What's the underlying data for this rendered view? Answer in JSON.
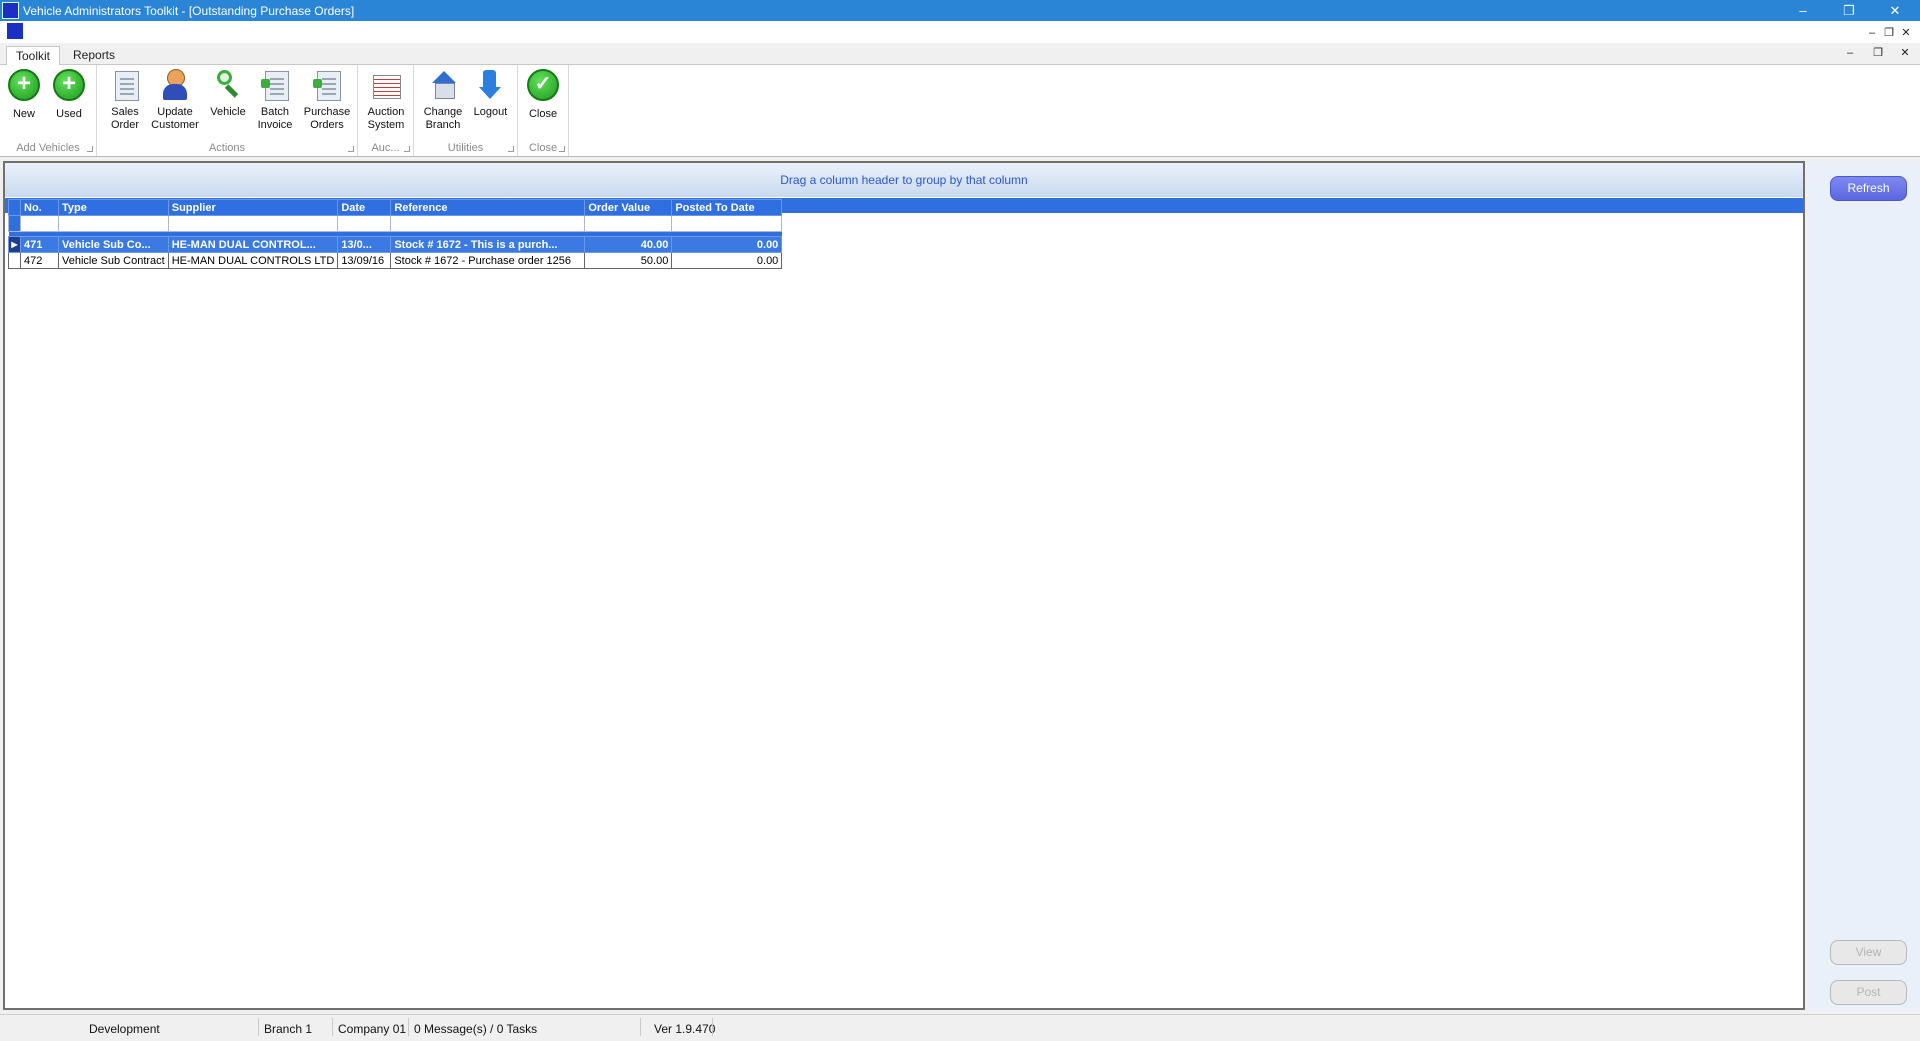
{
  "window": {
    "title": "Vehicle Administrators Toolkit - [Outstanding Purchase Orders]"
  },
  "ribbon": {
    "tabs": [
      "Toolkit",
      "Reports"
    ],
    "groups": {
      "add_vehicles": {
        "label": "Add Vehicles",
        "buttons": [
          "New",
          "Used"
        ]
      },
      "actions": {
        "label": "Actions",
        "buttons": [
          [
            "Sales",
            "Order"
          ],
          [
            "Update",
            "Customer"
          ],
          [
            "Vehicle"
          ],
          [
            "Batch",
            "Invoice"
          ],
          [
            "Purchase",
            "Orders"
          ]
        ]
      },
      "auction": {
        "label": "Auc...",
        "buttons": [
          [
            "Auction",
            "System"
          ]
        ]
      },
      "utilities": {
        "label": "Utilities",
        "buttons": [
          [
            "Change",
            "Branch"
          ],
          [
            "Logout"
          ]
        ]
      },
      "close": {
        "label": "Close",
        "buttons": [
          "Close"
        ]
      }
    }
  },
  "grid": {
    "group_hint": "Drag a column header to group by that column",
    "columns": [
      "No.",
      "Type",
      "Supplier",
      "Date",
      "Reference",
      "Order Value",
      "Posted To Date"
    ],
    "rows": [
      [
        "471",
        "Vehicle Sub Co...",
        "HE-MAN DUAL CONTROL...",
        "13/0...",
        "Stock # 1672 - This is a purch...",
        "40.00",
        "0.00"
      ],
      [
        "472",
        "Vehicle Sub Contract",
        "HE-MAN DUAL CONTROLS LTD",
        "13/09/16",
        "Stock # 1672 - Purchase order 1256",
        "50.00",
        "0.00"
      ]
    ],
    "selected_row": 0
  },
  "side": {
    "refresh": "Refresh",
    "view": "View",
    "post": "Post"
  },
  "status": {
    "environment": "Development",
    "branch": "Branch 1",
    "company": "Company 01",
    "messages": "0 Message(s) / 0 Tasks",
    "version": "Ver 1.9.470"
  }
}
